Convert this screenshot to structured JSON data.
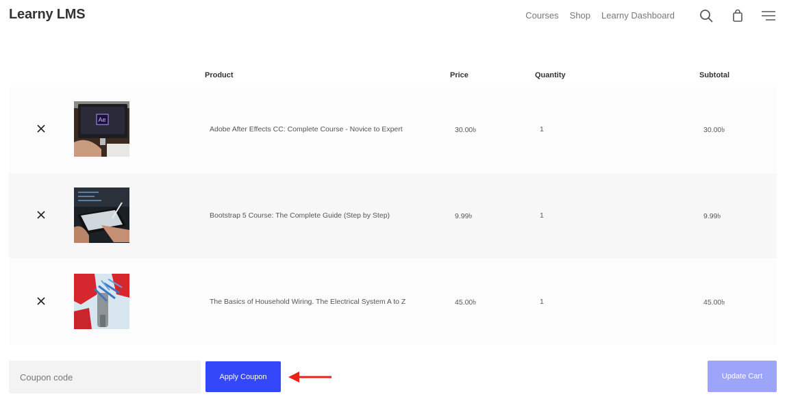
{
  "header": {
    "brand": "Learny LMS",
    "nav": [
      {
        "label": "Courses"
      },
      {
        "label": "Shop"
      },
      {
        "label": "Learny Dashboard"
      }
    ],
    "icons": [
      "search-icon",
      "cart-bag-icon",
      "menu-icon"
    ]
  },
  "cart": {
    "columns": {
      "product": "Product",
      "price": "Price",
      "quantity": "Quantity",
      "subtotal": "Subtotal"
    },
    "items": [
      {
        "name": "Adobe After Effects CC: Complete Course - Novice to Expert",
        "price": "30.00৳",
        "quantity": "1",
        "subtotal": "30.00৳",
        "thumb_badge": "Ae"
      },
      {
        "name": "Bootstrap 5 Course: The Complete Guide (Step by Step)",
        "price": "9.99৳",
        "quantity": "1",
        "subtotal": "9.99৳"
      },
      {
        "name": "The Basics of Household Wiring. The Electrical System A to Z",
        "price": "45.00৳",
        "quantity": "1",
        "subtotal": "45.00৳"
      }
    ]
  },
  "actions": {
    "coupon_placeholder": "Coupon code",
    "apply_label": "Apply Coupon",
    "update_label": "Update Cart"
  },
  "colors": {
    "primary": "#3447f9",
    "primary_disabled": "#9da5fb",
    "annotation_arrow": "#e8221b"
  }
}
